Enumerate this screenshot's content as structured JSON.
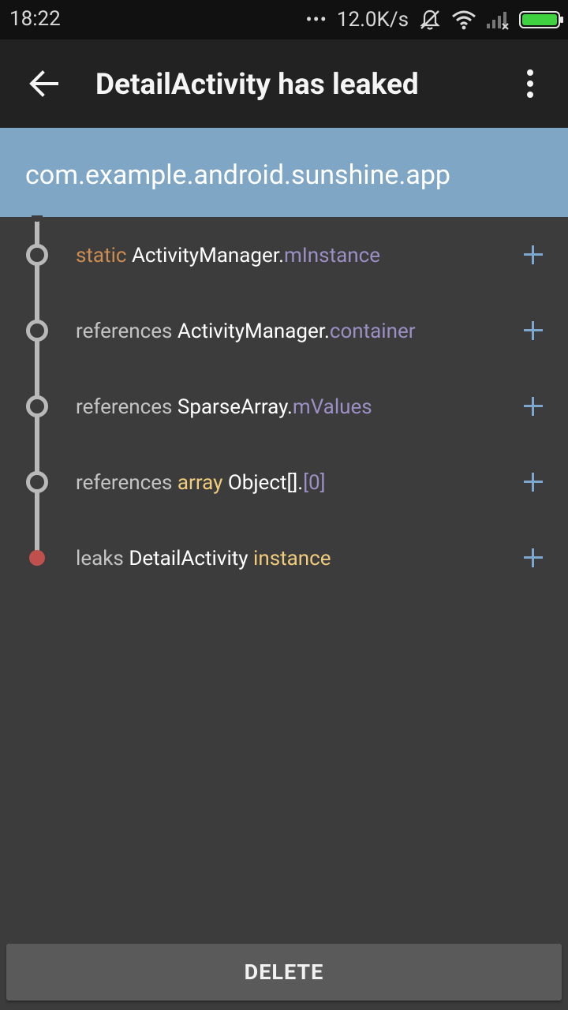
{
  "status_bar": {
    "time": "18:22",
    "dots": "•••",
    "speed": "12.0K/s",
    "icons": [
      "notification-off-icon",
      "wifi-icon",
      "signal-icon",
      "battery-icon"
    ],
    "battery_color": "#3fd13f"
  },
  "app_bar": {
    "back_icon": "arrow-left-icon",
    "title": "DetailActivity has leaked",
    "menu_icon": "more-vert-icon"
  },
  "header": {
    "package": "com.example.android.sunshine.app",
    "background": "#7fa6c5"
  },
  "trace": [
    {
      "prefix": "static",
      "class": "ActivityManager",
      "dot": ".",
      "field": "mInstance",
      "node": "hollow"
    },
    {
      "prefix": "references",
      "class": "ActivityManager",
      "dot": ".",
      "field": "container",
      "node": "hollow"
    },
    {
      "prefix": "references",
      "class": "SparseArray",
      "dot": ".",
      "field": "mValues",
      "node": "hollow"
    },
    {
      "prefix": "references",
      "qualifier": "array",
      "class": "Object[]",
      "dot": ".",
      "field": "[0]",
      "node": "hollow"
    },
    {
      "prefix": "leaks",
      "class": "DetailActivity",
      "qualifier": "instance",
      "node": "leak"
    }
  ],
  "colors": {
    "static": "#cd8c52",
    "reference": "#c4c4c4",
    "field": "#9b8fc4",
    "qualifier": "#f0cc7c",
    "leak_node": "#c0504d",
    "expand_icon": "#7ea7d0"
  },
  "footer": {
    "delete_label": "DELETE"
  }
}
